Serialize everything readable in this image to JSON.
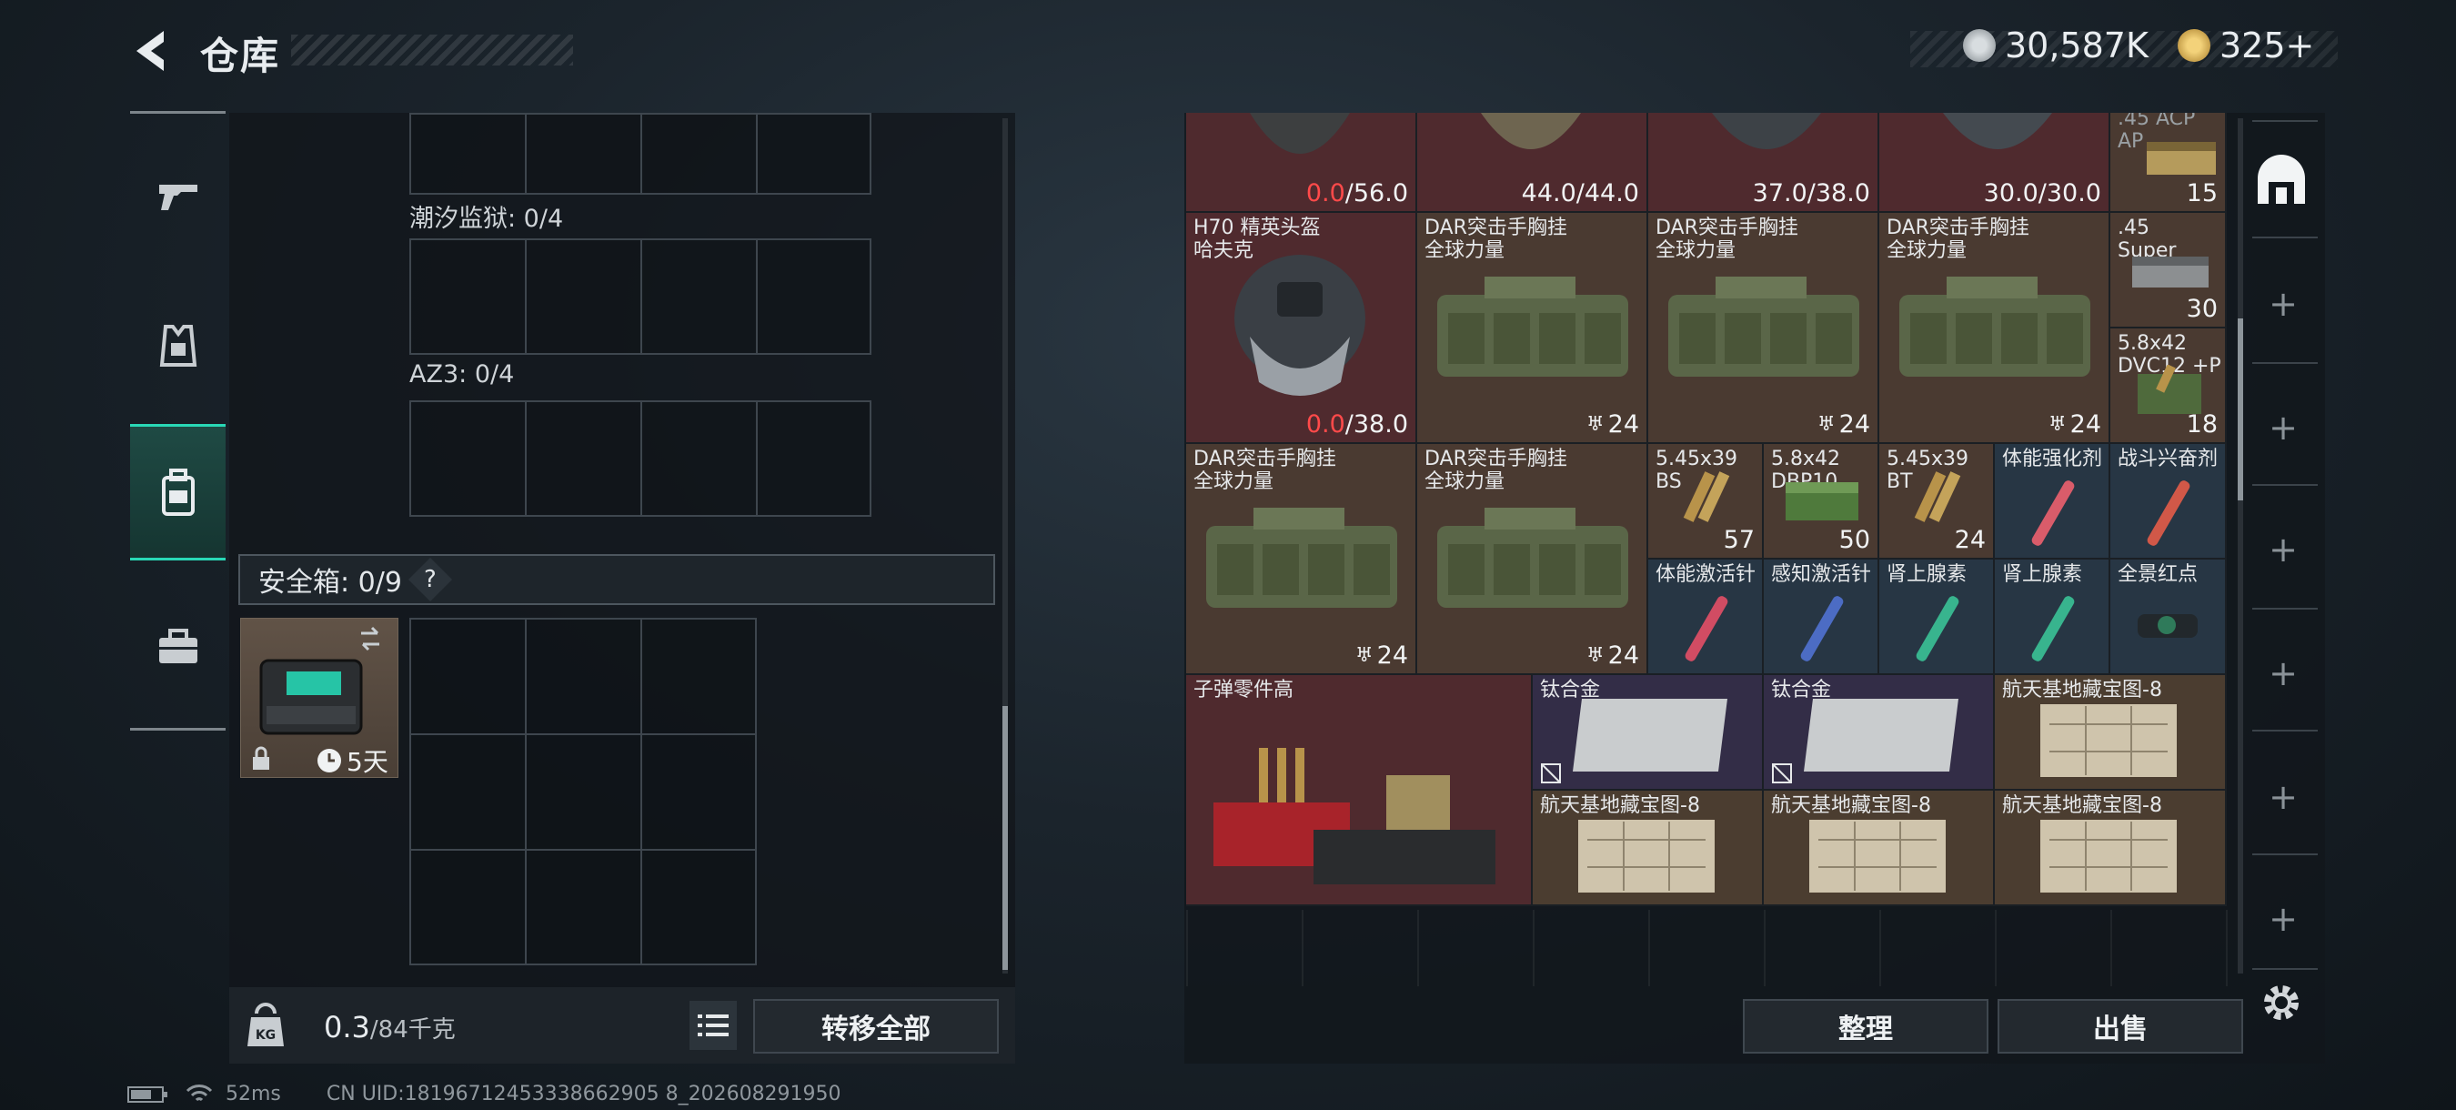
{
  "header": {
    "title": "仓库",
    "currency_silver": "30,587K",
    "currency_gold": "325+"
  },
  "left_panel": {
    "sections": [
      {
        "label": "潮汐监狱: 0/4"
      },
      {
        "label": "AZ3: 0/4"
      }
    ],
    "safe_box": {
      "label": "安全箱: 0/9",
      "help": "?",
      "timer": "5天"
    },
    "weight": {
      "current": "0.3",
      "max": "/84千克"
    },
    "transfer_all": "转移全部"
  },
  "items": [
    {
      "id": "r0c0",
      "name": "",
      "value_red": "0.0",
      "value": "/56.0"
    },
    {
      "id": "r0c1",
      "name": "",
      "value": "44.0/44.0"
    },
    {
      "id": "r0c2",
      "name": "",
      "value": "37.0/38.0"
    },
    {
      "id": "r0c3",
      "name": "",
      "value": "30.0/30.0"
    },
    {
      "id": "r0c4",
      "name": ".45 ACP\nAP",
      "value": "15"
    },
    {
      "id": "helmet",
      "name": "H70 精英头盔\n哈夫克",
      "value_red": "0.0",
      "value": "/38.0"
    },
    {
      "id": "vest1",
      "name": "DAR突击手胸挂\n全球力量",
      "count": "24"
    },
    {
      "id": "vest2",
      "name": "DAR突击手胸挂\n全球力量",
      "count": "24"
    },
    {
      "id": "vest3",
      "name": "DAR突击手胸挂\n全球力量",
      "count": "24"
    },
    {
      "id": "ammo45",
      "name": ".45\nSuper",
      "value": "30"
    },
    {
      "id": "ammo58dvc",
      "name": "5.8x42\nDVC12 +P",
      "value": "18"
    },
    {
      "id": "vest4",
      "name": "DAR突击手胸挂\n全球力量",
      "count": "24"
    },
    {
      "id": "vest5",
      "name": "DAR突击手胸挂\n全球力量",
      "count": "24"
    },
    {
      "id": "ammo545bs",
      "name": "5.45x39\nBS",
      "value": "57"
    },
    {
      "id": "ammo58dbp",
      "name": "5.8x42\nDBP10",
      "value": "50"
    },
    {
      "id": "ammo545bt",
      "name": "5.45x39\nBT",
      "value": "24"
    },
    {
      "id": "inj1",
      "name": "体能强化剂"
    },
    {
      "id": "inj2",
      "name": "战斗兴奋剂"
    },
    {
      "id": "inj3",
      "name": "体能激活针"
    },
    {
      "id": "inj4",
      "name": "感知激活针"
    },
    {
      "id": "inj5",
      "name": "肾上腺素"
    },
    {
      "id": "inj6",
      "name": "肾上腺素"
    },
    {
      "id": "sight",
      "name": "全景红点"
    },
    {
      "id": "parts",
      "name": "子弹零件高"
    },
    {
      "id": "ti1",
      "name": "钛合金"
    },
    {
      "id": "ti2",
      "name": "钛合金"
    },
    {
      "id": "map1",
      "name": "航天基地藏宝图-8"
    },
    {
      "id": "map2",
      "name": "航天基地藏宝图-8"
    },
    {
      "id": "map3",
      "name": "航天基地藏宝图-8"
    },
    {
      "id": "map4",
      "name": "航天基地藏宝图-8"
    }
  ],
  "actions": {
    "sort": "整理",
    "sell": "出售"
  },
  "status_bar": {
    "ping": "52ms",
    "uid": "CN UID:18196712453338662905 8_202608291950"
  },
  "colors": {
    "accent": "#29d8b6",
    "danger": "#ff4a4a"
  }
}
